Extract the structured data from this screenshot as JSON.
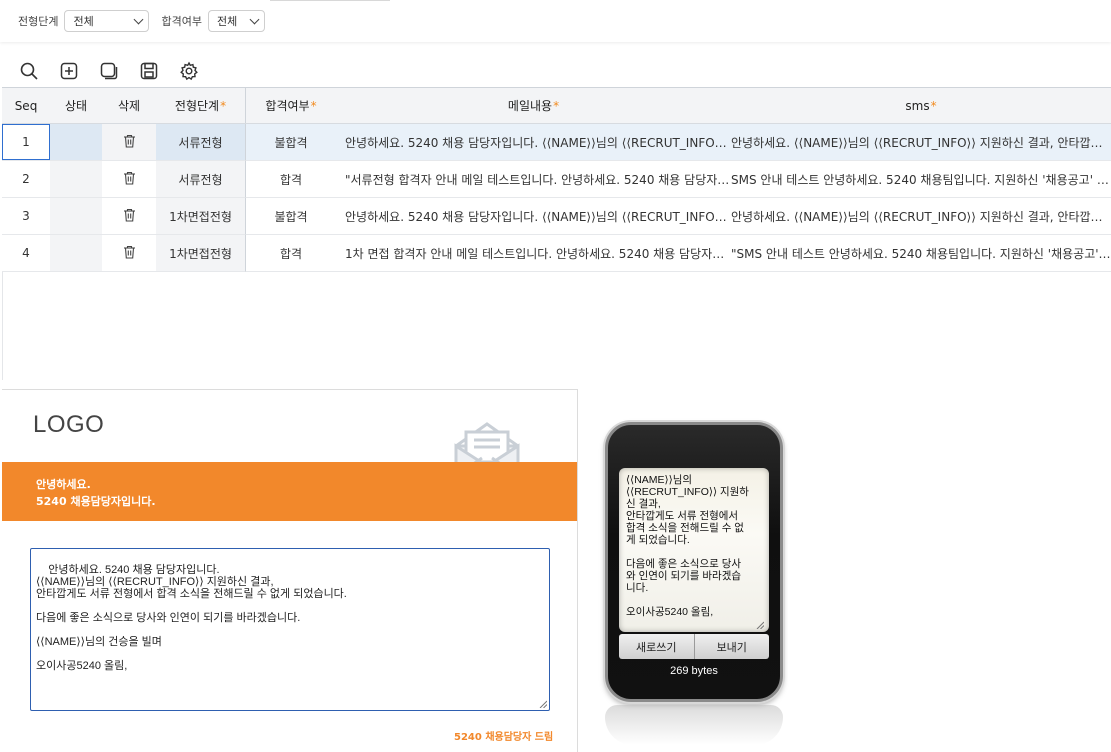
{
  "filters": {
    "stage_label": "전형단계",
    "stage_value": "전체",
    "pass_label": "합격여부",
    "pass_value": "전체"
  },
  "toolbar": {
    "search": "search-icon",
    "add": "add-icon",
    "copy": "copy-icon",
    "save": "save-icon",
    "settings": "gear-icon"
  },
  "grid": {
    "columns": {
      "seq": "Seq",
      "status": "상태",
      "delete": "삭제",
      "stage": "전형단계",
      "pass": "합격여부",
      "mail": "메일내용",
      "sms": "sms",
      "required_mark": "*"
    },
    "rows": [
      {
        "seq": "1",
        "stage": "서류전형",
        "pass": "불합격",
        "mail": "안녕하세요. 5240 채용 담당자입니다. ⟨⟨NAME⟩⟩님의 ⟨⟨RECRUT_INFO⟩⟩ …",
        "sms": "안녕하세요. ⟨⟨NAME⟩⟩님의 ⟨⟨RECRUT_INFO⟩⟩ 지원하신 결과, 안타깝게 …"
      },
      {
        "seq": "2",
        "stage": "서류전형",
        "pass": "합격",
        "mail": "\"서류전형 합격자 안내 메일 테스트입니다.  안녕하세요. 5240 채용 담당자입…",
        "sms": "SMS 안내 테스트  안녕하세요. 5240 채용팀입니다. 지원하신 '채용공고' 서…"
      },
      {
        "seq": "3",
        "stage": "1차면접전형",
        "pass": "불합격",
        "mail": "안녕하세요. 5240 채용 담당자입니다. ⟨⟨NAME⟩⟩님의 ⟨⟨RECRUT_INFO⟩⟩ …",
        "sms": "안녕하세요. ⟨⟨NAME⟩⟩님의 ⟨⟨RECRUT_INFO⟩⟩ 지원하신 결과, 안타깝게 …"
      },
      {
        "seq": "4",
        "stage": "1차면접전형",
        "pass": "합격",
        "mail": "1차 면접 합격자 안내 메일 테스트입니다.  안녕하세요. 5240 채용 담당자입…",
        "sms": "\"SMS 안내 테스트  안녕하세요. 5240 채용팀입니다. 지원하신 '채용공고' 1…"
      }
    ]
  },
  "mail_preview": {
    "logo": "LOGO",
    "banner_line1": "안녕하세요.",
    "banner_line2": "5240 채용담당자입니다.",
    "body": "안녕하세요. 5240 채용 담당자입니다.\n⟨⟨NAME⟩⟩님의 ⟨⟨RECRUT_INFO⟩⟩ 지원하신 결과,\n안타깝게도 서류 전형에서 합격 소식을 전해드릴 수 없게 되었습니다.\n\n다음에 좋은 소식으로 당사와 인연이 되기를 바라겠습니다.\n\n⟨⟨NAME⟩⟩님의 건승을 빌며\n\n오이사공5240 올림,",
    "signature": "5240 채용담당자 드림"
  },
  "sms_preview": {
    "body": "⟨⟨NAME⟩⟩님의\n⟨⟨RECRUT_INFO⟩⟩ 지원하\n신 결과,\n안타깝게도 서류 전형에서\n합격 소식을 전해드릴 수 없\n게 되었습니다.\n\n다음에 좋은 소식으로 당사\n와 인연이 되기를 바라겠습\n니다.\n\n오이사공5240 올림,",
    "new_button": "새로쓰기",
    "send_button": "보내기",
    "bytes": "269 bytes"
  },
  "colors": {
    "accent": "#f2882b",
    "selection_border": "#2f6fd0"
  }
}
